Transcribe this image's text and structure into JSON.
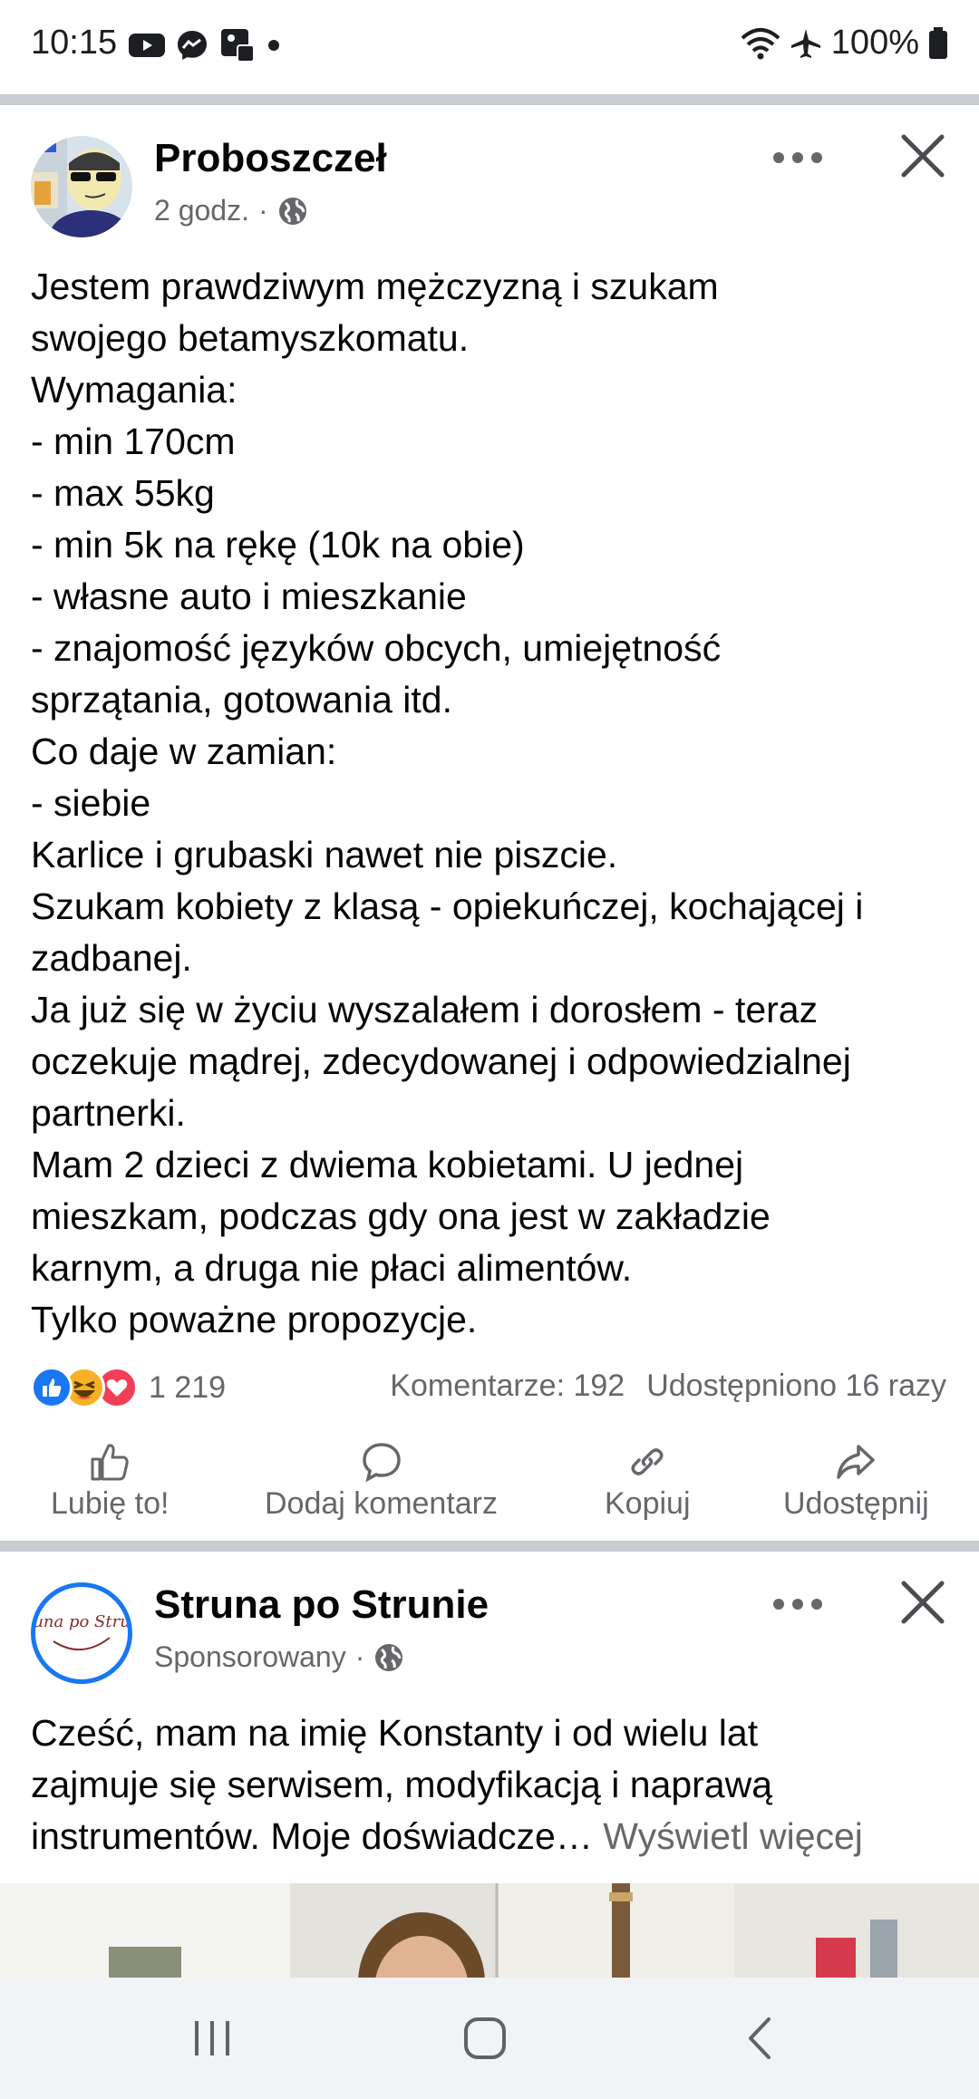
{
  "status_bar": {
    "time": "10:15",
    "battery": "100%",
    "left_icons": [
      "youtube-icon",
      "messenger-icon",
      "photo-icon",
      "dot-icon"
    ],
    "right_icons": [
      "wifi-icon",
      "airplane-mode-icon",
      "battery-icon"
    ]
  },
  "post1": {
    "author": "Proboszczeł",
    "time": "2 godz.",
    "separator": "·",
    "text": "Jestem prawdziwym mężczyzną i szukam\nswojego betamyszkomatu.\nWymagania:\n- min 170cm\n- max 55kg\n- min 5k na rękę (10k na obie)\n- własne auto i mieszkanie\n- znajomość języków obcych, umiejętność\nsprzątania, gotowania itd.\nCo daje w zamian:\n- siebie\nKarlice i grubaski nawet nie piszcie.\nSzukam kobiety z klasą - opiekuńczej, kochającej i\nzadbanej.\nJa już się w życiu wyszalałem i dorosłem - teraz\noczekuje mądrej, zdecydowanej i odpowiedzialnej\npartnerki.\nMam 2 dzieci z dwiema kobietami. U jednej\nmieszkam, podczas gdy ona jest w zakładzie\nkarnym, a druga nie płaci alimentów.\nTylko poważne propozycje.",
    "reaction_count": "1 219",
    "comments": "Komentarze: 192",
    "shares": "Udostępniono 16 razy"
  },
  "actions": {
    "like": "Lubię to!",
    "comment": "Dodaj komentarz",
    "copy": "Kopiuj",
    "share": "Udostępnij"
  },
  "post2": {
    "author": "Struna po Strunie",
    "sponsored": "Sponsorowany",
    "separator": "·",
    "text": "Cześć, mam na imię Konstanty i od wielu lat\nzajmuje się serwisem, modyfikacją i naprawą\ninstrumentów. Moje doświadcze…",
    "see_more": "Wyświetl więcej",
    "logo_text": "Struna po Strunie"
  },
  "colors": {
    "secondary_text": "#65676b",
    "like_blue": "#1877f2",
    "love_red": "#f33e58",
    "haha_yellow": "#f7b125",
    "divider": "#c9ccd1"
  }
}
